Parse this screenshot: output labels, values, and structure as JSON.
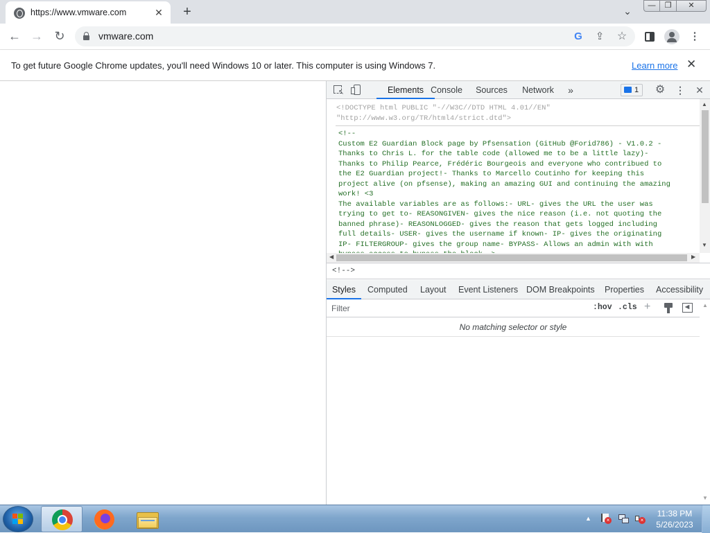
{
  "browser": {
    "tab": {
      "title": "https://www.vmware.com",
      "close_glyph": "✕"
    },
    "new_tab_glyph": "+",
    "tab_search_glyph": "⌄",
    "window_controls": {
      "minimize": "—",
      "maximize": "❐",
      "close": "✕"
    },
    "toolbar": {
      "back": "←",
      "forward": "→",
      "reload": "↻",
      "menu": "⋮"
    },
    "omnibox": {
      "url": "vmware.com"
    },
    "omnibox_icons": {
      "google": "G",
      "share": "⇪",
      "bookmark": "☆"
    },
    "infobar": {
      "message": "To get future Google Chrome updates, you'll need Windows 10 or later. This computer is using Windows 7.",
      "link": "Learn more",
      "close_glyph": "✕"
    }
  },
  "devtools": {
    "tabs": [
      "Elements",
      "Console",
      "Sources",
      "Network"
    ],
    "more_tabs_glyph": "»",
    "issues_count": "1",
    "settings_glyph": "⚙",
    "menu_glyph": "⋮",
    "close_glyph": "✕",
    "dom": {
      "doctype": "<!DOCTYPE html PUBLIC \"-//W3C//DTD HTML 4.01//EN\"\n\"http://www.w3.org/TR/html4/strict.dtd\">",
      "comment": "<!--\nCustom E2 Guardian Block page by Pfsensation (GitHub @Forid786) - V1.0.2 -\nThanks to Chris L. for the table code (allowed me to be a little lazy)-\nThanks to Philip Pearce, Frédéric Bourgeois and everyone who contribued to\nthe E2 Guardian project!- Thanks to Marcello Coutinho for keeping this\nproject alive (on pfsense), making an amazing GUI and continuing the amazing\nwork! <3\nThe available variables are as follows:- URL- gives the URL the user was\ntrying to get to- REASONGIVEN- gives the nice reason (i.e. not quoting the\nbanned phrase)- REASONLOGGED- gives the reason that gets logged including\nfull details- USER- gives the username if known- IP- gives the originating\nIP- FILTERGROUP- gives the group name- BYPASS- Allows an admin with with\nbypass access to bypass the block ->"
    },
    "breadcrumb": "<!-->",
    "styles_tabs": [
      "Styles",
      "Computed",
      "Layout",
      "Event Listeners",
      "DOM Breakpoints",
      "Properties",
      "Accessibility"
    ],
    "filter": {
      "placeholder": "Filter",
      "hov": ":hov",
      "cls": ".cls",
      "plus": "+"
    },
    "no_match": "No matching selector or style"
  },
  "taskbar": {
    "apps": [
      "chrome",
      "firefox",
      "explorer"
    ],
    "tray_arrow": "▲",
    "clock": {
      "time": "11:38 PM",
      "date": "5/26/2023"
    }
  },
  "colors": {
    "accent": "#1a73e8",
    "comment_green": "#236e25",
    "taskbar": "#7fa6cc"
  }
}
